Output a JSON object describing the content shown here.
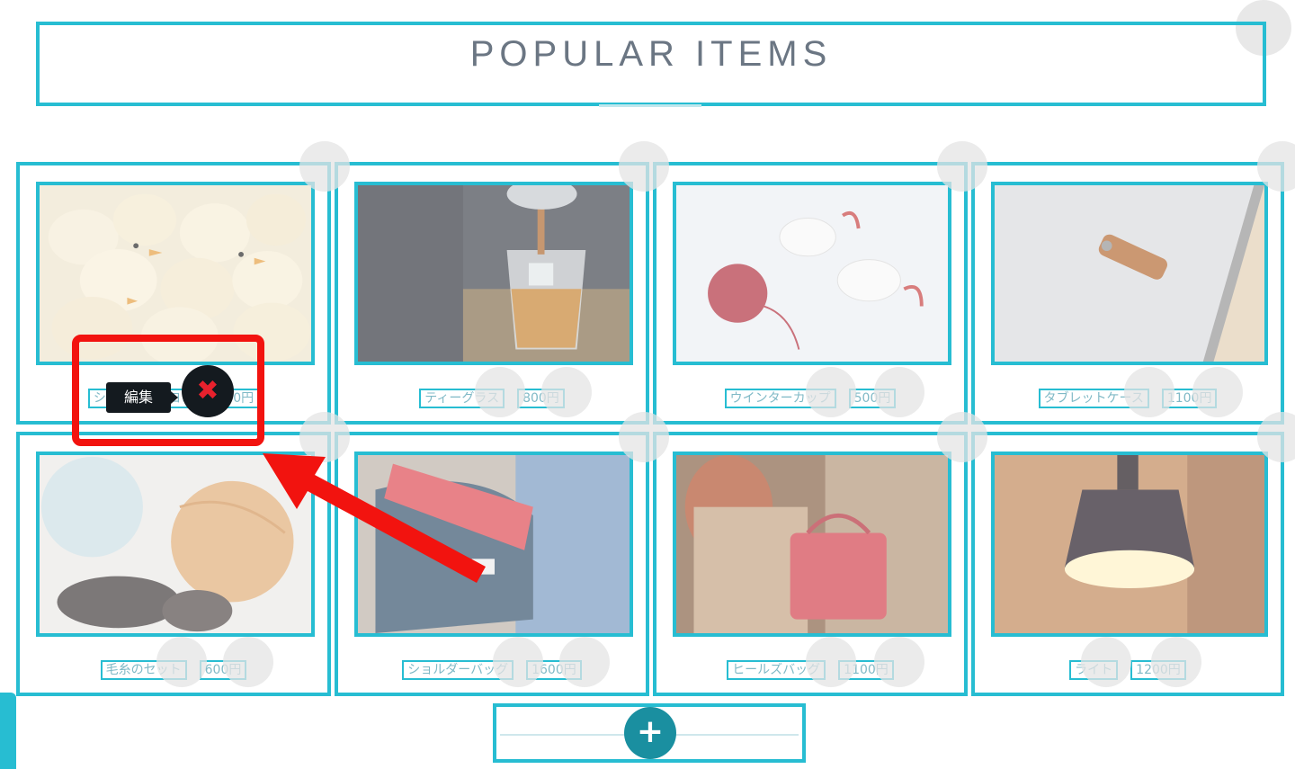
{
  "section": {
    "title": "POPULAR ITEMS"
  },
  "items": [
    {
      "name": "シンプルなヒヨコ",
      "price": "350円",
      "image": "chicks"
    },
    {
      "name": "ティーグラス",
      "price": "800円",
      "image": "tea-glass"
    },
    {
      "name": "ウインターカップ",
      "price": "500円",
      "image": "winter-cups"
    },
    {
      "name": "タブレットケース",
      "price": "1100円",
      "image": "tablet-case"
    },
    {
      "name": "毛糸のセット",
      "price": "600円",
      "image": "yarn"
    },
    {
      "name": "ショルダーバッグ",
      "price": "1600円",
      "image": "messenger-bag"
    },
    {
      "name": "ヒールズバッグ",
      "price": "1100円",
      "image": "handbag"
    },
    {
      "name": "ライト",
      "price": "1200円",
      "image": "lamp"
    }
  ],
  "overlay": {
    "tooltip_label": "編集",
    "delete_glyph": "✖",
    "add_glyph": "+"
  },
  "colors": {
    "frame": "#27bdd2",
    "highlight": "#f2130f",
    "add_button": "#1a8fa0"
  }
}
